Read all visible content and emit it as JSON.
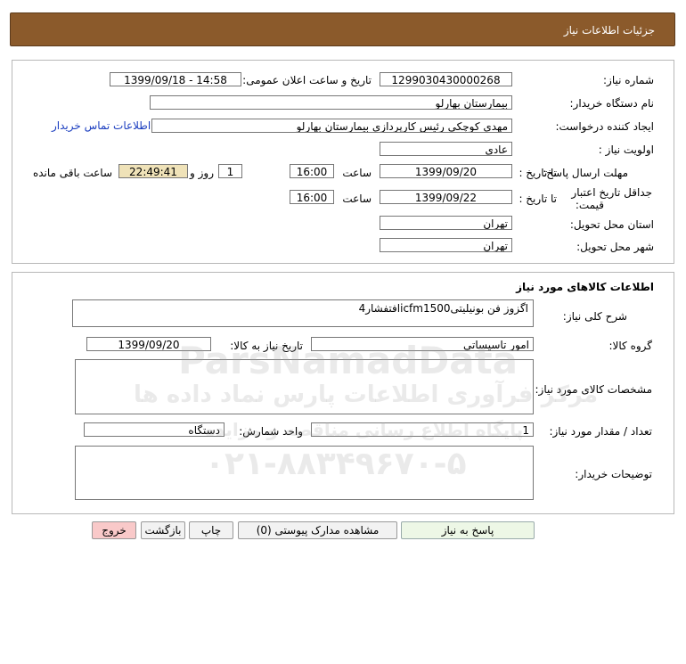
{
  "header": {
    "title": "جزئیات اطلاعات نیاز"
  },
  "details": {
    "need_number_label": "شماره نیاز:",
    "need_number": "1299030430000268",
    "announce_label": "تاریخ و ساعت اعلان عمومی:",
    "announce_value": "1399/09/18 - 14:58",
    "buyer_org_label": "نام دستگاه خریدار:",
    "buyer_org": "بیمارستان بهارلو",
    "creator_label": "ایجاد کننده درخواست:",
    "creator": "مهدی کوچکی  رئیس کارپردازی بیمارستان بهارلو",
    "contact_link": "اطلاعات تماس خریدار",
    "priority_label": "اولویت نیاز :",
    "priority": "عادي",
    "deadline_label": "مهلت ارسال پاسخ:",
    "to_date_label": "تا تاریخ :",
    "deadline_date": "1399/09/20",
    "time_label": "ساعت",
    "deadline_time": "16:00",
    "days_value": "1",
    "days_label": "روز و",
    "remaining_time": "22:49:41",
    "remaining_label": "ساعت باقی مانده",
    "validity_label_1": "جداقل تاریخ اعتبار",
    "validity_label_2": "قیمت:",
    "validity_to_label": "تا تاریخ :",
    "validity_date": "1399/09/22",
    "validity_time_label": "ساعت",
    "validity_time": "16:00",
    "province_label": "استان محل تحویل:",
    "province": "تهران",
    "city_label": "شهر محل تحویل:",
    "city": "تهران"
  },
  "goods": {
    "section_title": "اطلاعات کالاهای مورد نیاز",
    "description_label": "شرح کلی نیاز:",
    "description": "اگزوز فن بونیلیتیicfm1500افتفشار4",
    "group_label": "گروه کالا:",
    "group": "امور تاسیساتی",
    "need_date_label": "تاریخ نیاز به کالا:",
    "need_date": "1399/09/20",
    "specs_label": "مشخصات کالای مورد نیاز:",
    "specs": "",
    "quantity_label": "تعداد / مقدار مورد نیاز:",
    "quantity": "1",
    "unit_label": "واحد شمارش:",
    "unit": "دستگاه",
    "buyer_notes_label": "توضیحات خریدار:",
    "buyer_notes": ""
  },
  "buttons": {
    "reply": "پاسخ به نیاز",
    "attachments": "مشاهده مدارک پیوستی (0)",
    "print": "چاپ",
    "back": "بازگشت",
    "exit": "خروج"
  },
  "watermark": {
    "brand": "ParsNamadData",
    "line1": "مرکز فرآوری اطلاعات پارس نماد داده ها",
    "line2": "پایگاه اطلاع رسانی مناقصه و مزایده",
    "phone": "۰۲۱-۸۸۳۴۹۶۷۰-۵"
  },
  "colors": {
    "header_bg": "#8b5a2b",
    "exit_button": "#f9c9c9",
    "remaining_bg": "#efe2b8",
    "link": "#1a3dbf"
  }
}
